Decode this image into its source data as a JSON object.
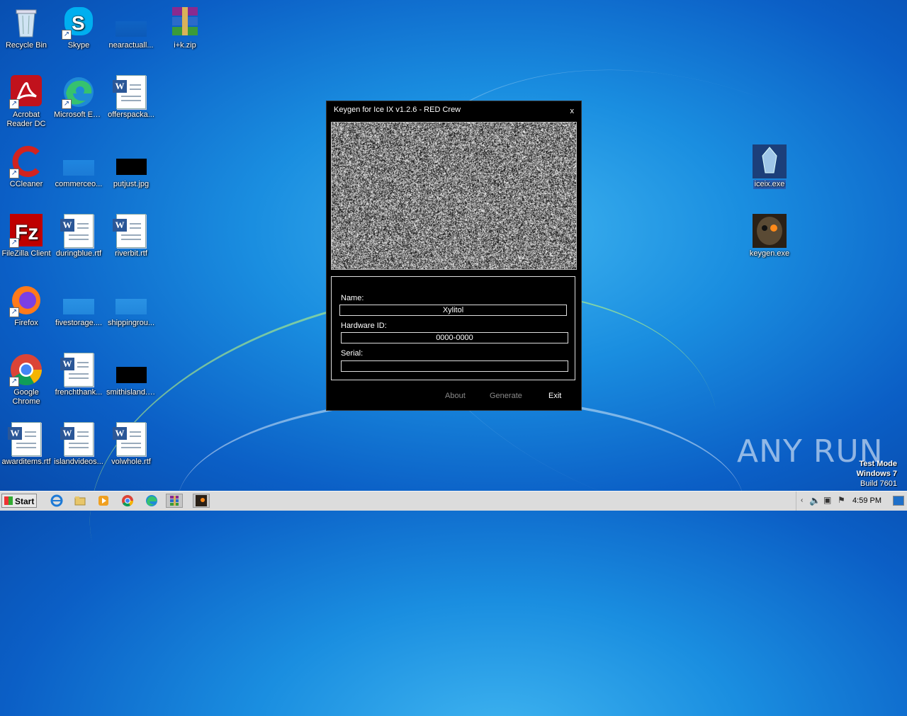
{
  "desktop": {
    "icons": [
      {
        "label": "Recycle Bin"
      },
      {
        "label": "Skype"
      },
      {
        "label": "nearactuall..."
      },
      {
        "label": "i+k.zip"
      },
      {
        "label": "Acrobat Reader DC"
      },
      {
        "label": "Microsoft Edge"
      },
      {
        "label": "offerspacka..."
      },
      {
        "label": "CCleaner"
      },
      {
        "label": "commerceo..."
      },
      {
        "label": "putjust.jpg"
      },
      {
        "label": "FileZilla Client"
      },
      {
        "label": "duringblue.rtf"
      },
      {
        "label": "riverbit.rtf"
      },
      {
        "label": "Firefox"
      },
      {
        "label": "fivestorage...."
      },
      {
        "label": "shippingrou..."
      },
      {
        "label": "Google Chrome"
      },
      {
        "label": "frenchthank..."
      },
      {
        "label": "smithisland.jpg"
      },
      {
        "label": "awarditems.rtf"
      },
      {
        "label": "islandvideos..."
      },
      {
        "label": "volwhole.rtf"
      },
      {
        "label": "iceix.exe"
      },
      {
        "label": "keygen.exe"
      }
    ]
  },
  "dialog": {
    "title": "Keygen for Ice IX v1.2.6 - RED Crew",
    "close": "x",
    "name_label": "Name:",
    "name_value": "Xylitol",
    "hwid_label": "Hardware ID:",
    "hwid_value": "0000-0000",
    "serial_label": "Serial:",
    "serial_value": "",
    "about": "About",
    "generate": "Generate",
    "exit": "Exit"
  },
  "taskbar": {
    "start": "Start",
    "clock": "4:59 PM"
  },
  "watermark": {
    "line1": "Test Mode",
    "line2": "Windows 7",
    "line3": "Build 7601",
    "brand": "ANY RUN"
  },
  "colors": {
    "dialog_bg": "#000000",
    "desktop_blue": "#1a8ee0",
    "disabled_text": "#8a8a8a"
  }
}
